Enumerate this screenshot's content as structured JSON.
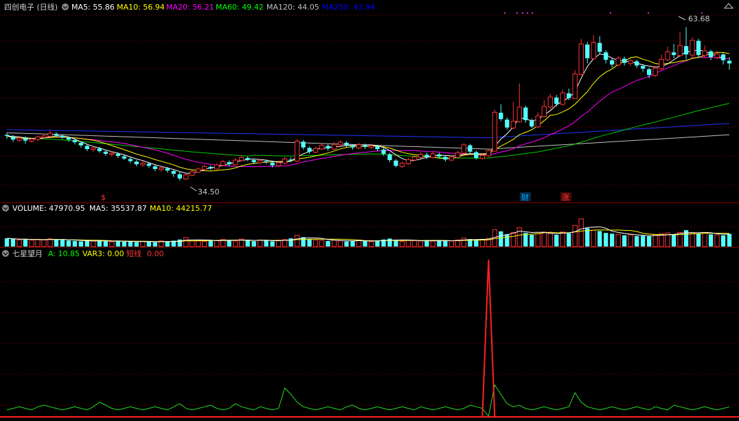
{
  "price_panel": {
    "title": "四创电子 (日线)",
    "indicators": [
      {
        "label": "MA5: 55.86",
        "color": "#ffffff"
      },
      {
        "label": "MA10: 56.94",
        "color": "#ffff00"
      },
      {
        "label": "MA20: 56.21",
        "color": "#ff00ff"
      },
      {
        "label": "MA60: 49.42",
        "color": "#00ff00"
      },
      {
        "label": "MA120: 44.05",
        "color": "#c0c0c0"
      },
      {
        "label": "MA250: 43.94",
        "color": "#0000ff"
      }
    ],
    "high_label": "63.68",
    "low_label": "34.50",
    "markers": [
      {
        "text": "$",
        "color": "#ff3333"
      },
      {
        "text": "财",
        "color": "#00aaff"
      },
      {
        "text": "涨",
        "color": "#ff3333"
      }
    ]
  },
  "volume_panel": {
    "indicators": [
      {
        "label": "VOLUME: 47970.95",
        "color": "#ffffff"
      },
      {
        "label": "MA5: 35537.87",
        "color": "#ffffff"
      },
      {
        "label": "MA10: 44215.77",
        "color": "#ffff00"
      }
    ]
  },
  "indicator_panel": {
    "name": "七星望月",
    "indicators": [
      {
        "label": "A: 10.85",
        "color": "#00ff00"
      },
      {
        "label": "VAR3: 0.00",
        "color": "#ffff00"
      },
      {
        "label": "短线",
        "color": "#ff3333"
      },
      {
        "label": "0.00",
        "color": "#ff3333"
      }
    ]
  },
  "chart_data": {
    "type": "candlestick",
    "ylim": [
      32,
      66
    ],
    "candles": [
      [
        43.2,
        43.0,
        43.6,
        42.4
      ],
      [
        42.8,
        42.3,
        43.2,
        41.9
      ],
      [
        42.2,
        42.6,
        43.0,
        41.8
      ],
      [
        42.5,
        42.1,
        42.9,
        41.5
      ],
      [
        42.0,
        42.4,
        42.7,
        41.7
      ],
      [
        42.3,
        42.8,
        43.1,
        42.0
      ],
      [
        42.7,
        43.0,
        43.4,
        42.5
      ],
      [
        42.9,
        43.5,
        44.0,
        42.7
      ],
      [
        43.4,
        43.1,
        43.7,
        42.8
      ],
      [
        43.0,
        42.7,
        43.2,
        42.4
      ],
      [
        42.6,
        42.3,
        42.9,
        41.9
      ],
      [
        42.2,
        41.8,
        42.5,
        41.4
      ],
      [
        41.7,
        41.2,
        42.0,
        40.8
      ],
      [
        41.1,
        40.5,
        41.3,
        40.1
      ],
      [
        40.4,
        40.7,
        41.0,
        40.0
      ],
      [
        40.6,
        40.1,
        40.9,
        39.8
      ],
      [
        40.0,
        39.6,
        40.3,
        39.2
      ],
      [
        39.5,
        39.7,
        40.1,
        39.1
      ],
      [
        39.6,
        39.2,
        39.9,
        38.8
      ],
      [
        39.1,
        38.7,
        39.4,
        38.4
      ],
      [
        38.6,
        38.2,
        38.9,
        37.8
      ],
      [
        38.1,
        37.6,
        38.4,
        37.2
      ],
      [
        37.5,
        37.8,
        38.2,
        37.1
      ],
      [
        37.7,
        37.3,
        38.0,
        36.9
      ],
      [
        37.2,
        36.7,
        37.5,
        36.3
      ],
      [
        36.6,
        36.9,
        37.2,
        36.2
      ],
      [
        36.8,
        36.4,
        37.1,
        36.0
      ],
      [
        36.3,
        35.8,
        36.6,
        35.2
      ],
      [
        35.7,
        34.9,
        36.1,
        34.5
      ],
      [
        34.8,
        35.6,
        35.9,
        34.6
      ],
      [
        35.5,
        36.2,
        36.5,
        35.3
      ],
      [
        36.1,
        36.7,
        37.0,
        35.9
      ],
      [
        36.6,
        37.2,
        37.5,
        36.4
      ],
      [
        37.1,
        36.8,
        37.4,
        36.5
      ],
      [
        36.7,
        37.5,
        37.8,
        36.5
      ],
      [
        37.4,
        38.1,
        38.4,
        37.2
      ],
      [
        38.0,
        37.6,
        38.3,
        37.2
      ],
      [
        37.5,
        38.4,
        38.8,
        37.3
      ],
      [
        38.3,
        38.9,
        39.3,
        38.1
      ],
      [
        38.8,
        38.5,
        39.1,
        38.2
      ],
      [
        38.4,
        38.0,
        38.7,
        37.6
      ],
      [
        37.9,
        38.3,
        38.6,
        37.6
      ],
      [
        38.2,
        38.0,
        38.5,
        37.7
      ],
      [
        37.9,
        37.4,
        38.2,
        37.0
      ],
      [
        37.3,
        37.9,
        38.3,
        37.1
      ],
      [
        37.8,
        38.6,
        39.0,
        37.6
      ],
      [
        38.5,
        38.3,
        38.9,
        38.0
      ],
      [
        38.2,
        42.0,
        42.4,
        38.0
      ],
      [
        41.9,
        40.8,
        42.2,
        40.4
      ],
      [
        40.7,
        40.0,
        41.0,
        39.6
      ],
      [
        39.9,
        40.6,
        41.0,
        39.7
      ],
      [
        40.5,
        41.2,
        41.6,
        40.3
      ],
      [
        41.1,
        40.6,
        41.4,
        40.2
      ],
      [
        40.5,
        41.4,
        41.8,
        40.3
      ],
      [
        41.3,
        41.8,
        42.2,
        41.0
      ],
      [
        41.7,
        41.2,
        42.0,
        40.8
      ],
      [
        41.1,
        40.8,
        41.4,
        40.4
      ],
      [
        40.7,
        41.3,
        41.7,
        40.5
      ],
      [
        41.2,
        40.9,
        41.5,
        40.5
      ],
      [
        40.8,
        41.1,
        41.5,
        40.5
      ],
      [
        41.0,
        40.5,
        41.3,
        40.1
      ],
      [
        40.4,
        39.6,
        40.7,
        39.2
      ],
      [
        39.5,
        38.4,
        39.8,
        38.0
      ],
      [
        38.3,
        37.3,
        38.6,
        37.0
      ],
      [
        37.2,
        37.8,
        38.1,
        36.9
      ],
      [
        37.7,
        38.5,
        38.8,
        37.5
      ],
      [
        38.4,
        39.0,
        39.3,
        38.2
      ],
      [
        38.9,
        39.5,
        39.9,
        38.7
      ],
      [
        39.4,
        39.0,
        39.8,
        38.6
      ],
      [
        38.9,
        39.6,
        40.0,
        38.7
      ],
      [
        39.5,
        39.1,
        39.8,
        38.7
      ],
      [
        39.0,
        38.5,
        39.3,
        38.1
      ],
      [
        38.4,
        39.0,
        39.3,
        38.2
      ],
      [
        38.9,
        39.8,
        40.2,
        38.7
      ],
      [
        39.7,
        41.3,
        41.6,
        39.5
      ],
      [
        41.2,
        40.0,
        41.5,
        39.6
      ],
      [
        39.9,
        38.8,
        40.2,
        38.5
      ],
      [
        38.7,
        39.3,
        39.6,
        38.5
      ],
      [
        39.2,
        40.2,
        40.5,
        39.0
      ],
      [
        40.1,
        47.5,
        48.0,
        40.0
      ],
      [
        47.4,
        46.2,
        49.0,
        45.8
      ],
      [
        46.1,
        44.6,
        46.5,
        44.2
      ],
      [
        44.5,
        45.8,
        49.5,
        44.3
      ],
      [
        45.7,
        48.5,
        53.0,
        45.5
      ],
      [
        48.4,
        46.0,
        48.8,
        45.5
      ],
      [
        45.9,
        44.8,
        46.3,
        44.5
      ],
      [
        44.7,
        46.8,
        47.5,
        44.5
      ],
      [
        46.7,
        48.6,
        49.8,
        46.5
      ],
      [
        48.5,
        50.4,
        51.0,
        48.0
      ],
      [
        50.3,
        49.1,
        50.8,
        48.6
      ],
      [
        49.0,
        51.2,
        51.8,
        48.8
      ],
      [
        51.1,
        50.2,
        52.0,
        49.8
      ],
      [
        50.1,
        54.8,
        55.5,
        50.0
      ],
      [
        54.7,
        60.5,
        61.5,
        54.5
      ],
      [
        60.4,
        57.8,
        60.9,
        56.8
      ],
      [
        57.7,
        60.8,
        62.2,
        57.5
      ],
      [
        60.7,
        59.0,
        62.0,
        58.5
      ],
      [
        58.9,
        57.5,
        59.3,
        56.8
      ],
      [
        57.4,
        56.6,
        57.8,
        56.0
      ],
      [
        56.5,
        57.8,
        58.2,
        56.2
      ],
      [
        57.7,
        56.9,
        58.1,
        56.4
      ],
      [
        56.8,
        57.3,
        57.7,
        56.3
      ],
      [
        57.2,
        56.4,
        57.5,
        55.9
      ],
      [
        56.3,
        55.8,
        56.7,
        55.2
      ],
      [
        55.7,
        54.6,
        56.0,
        54.0
      ],
      [
        54.5,
        55.9,
        56.3,
        54.2
      ],
      [
        55.8,
        57.6,
        58.5,
        55.5
      ],
      [
        57.5,
        59.0,
        60.0,
        57.2
      ],
      [
        58.9,
        58.4,
        60.5,
        57.8
      ],
      [
        58.3,
        60.2,
        62.8,
        58.0
      ],
      [
        60.1,
        58.5,
        63.7,
        57.6
      ],
      [
        58.4,
        61.2,
        61.8,
        57.9
      ],
      [
        61.1,
        58.4,
        61.5,
        57.8
      ],
      [
        58.3,
        59.2,
        60.2,
        58.0
      ],
      [
        59.1,
        58.0,
        59.4,
        57.4
      ],
      [
        57.9,
        58.6,
        59.2,
        57.6
      ],
      [
        58.5,
        57.4,
        58.8,
        56.6
      ],
      [
        57.3,
        56.8,
        58.0,
        55.6
      ]
    ],
    "ma": {
      "MA5": [
        43.0,
        42.9,
        42.8,
        42.6,
        42.5,
        42.5,
        42.6,
        42.8,
        43.0,
        43.0,
        42.8,
        42.4,
        41.9,
        41.4,
        41.0,
        40.7,
        40.3,
        40.0,
        39.7,
        39.4,
        39.0,
        38.6,
        38.3,
        37.9,
        37.5,
        37.2,
        36.9,
        36.6,
        36.2,
        35.9,
        35.9,
        36.2,
        36.6,
        36.9,
        37.1,
        37.4,
        37.7,
        38.0,
        38.3,
        38.5,
        38.6,
        38.5,
        38.4,
        38.2,
        38.0,
        38.0,
        38.2,
        39.0,
        39.6,
        40.0,
        40.5,
        40.6,
        40.8,
        40.9,
        41.0,
        41.2,
        41.2,
        41.3,
        41.3,
        41.3,
        41.1,
        40.8,
        40.2,
        39.4,
        38.7,
        38.3,
        38.3,
        38.6,
        38.9,
        39.2,
        39.3,
        39.3,
        39.2,
        39.2,
        39.5,
        39.6,
        39.6,
        39.6,
        39.6,
        41.0,
        42.4,
        43.4,
        44.7,
        46.5,
        46.2,
        45.9,
        46.1,
        47.0,
        47.8,
        48.9,
        49.6,
        50.3,
        51.4,
        54.0,
        56.2,
        57.7,
        58.6,
        58.4,
        57.8,
        57.4,
        57.2,
        57.1,
        56.9,
        56.5,
        56.3,
        56.1,
        56.2,
        56.7,
        57.5,
        58.3,
        59.0,
        59.1,
        59.4,
        59.1,
        58.6,
        58.2,
        57.8
      ]
    },
    "volume": [
      35,
      32,
      28,
      30,
      27,
      31,
      29,
      33,
      30,
      28,
      26,
      24,
      22,
      25,
      23,
      27,
      22,
      20,
      24,
      21,
      23,
      19,
      22,
      20,
      18,
      24,
      21,
      25,
      30,
      38,
      26,
      24,
      22,
      28,
      25,
      30,
      27,
      24,
      32,
      26,
      23,
      28,
      25,
      22,
      27,
      30,
      35,
      48,
      40,
      32,
      28,
      26,
      24,
      27,
      25,
      22,
      24,
      28,
      23,
      21,
      26,
      30,
      34,
      28,
      22,
      26,
      25,
      24,
      26,
      23,
      25,
      27,
      24,
      28,
      36,
      32,
      30,
      28,
      34,
      72,
      65,
      52,
      60,
      80,
      58,
      50,
      55,
      62,
      58,
      50,
      62,
      56,
      90,
      118,
      78,
      70,
      66,
      58,
      55,
      52,
      48,
      50,
      45,
      46,
      44,
      50,
      55,
      58,
      52,
      60,
      70,
      58,
      54,
      60,
      52,
      50,
      48,
      54
    ],
    "indicator": {
      "A": [
        4,
        5,
        6,
        5,
        4,
        6,
        7,
        6,
        5,
        4,
        5,
        6,
        5,
        4,
        6,
        9,
        7,
        5,
        4,
        5,
        6,
        5,
        4,
        5,
        6,
        5,
        4,
        6,
        8,
        5,
        4,
        5,
        6,
        7,
        5,
        4,
        5,
        8,
        6,
        5,
        4,
        6,
        5,
        4,
        5,
        18,
        14,
        9,
        6,
        5,
        4,
        5,
        6,
        5,
        4,
        6,
        7,
        5,
        4,
        5,
        6,
        5,
        4,
        5,
        6,
        5,
        4,
        6,
        5,
        4,
        5,
        6,
        5,
        4,
        5,
        7,
        6,
        5,
        0,
        20,
        14,
        8,
        6,
        7,
        5,
        4,
        5,
        6,
        5,
        4,
        5,
        6,
        15,
        9,
        6,
        5,
        4,
        5,
        6,
        5,
        4,
        5,
        6,
        5,
        4,
        6,
        5,
        4,
        7,
        6,
        5,
        4,
        5,
        6,
        5,
        4,
        5,
        6
      ],
      "short_line_spike": 78
    }
  }
}
